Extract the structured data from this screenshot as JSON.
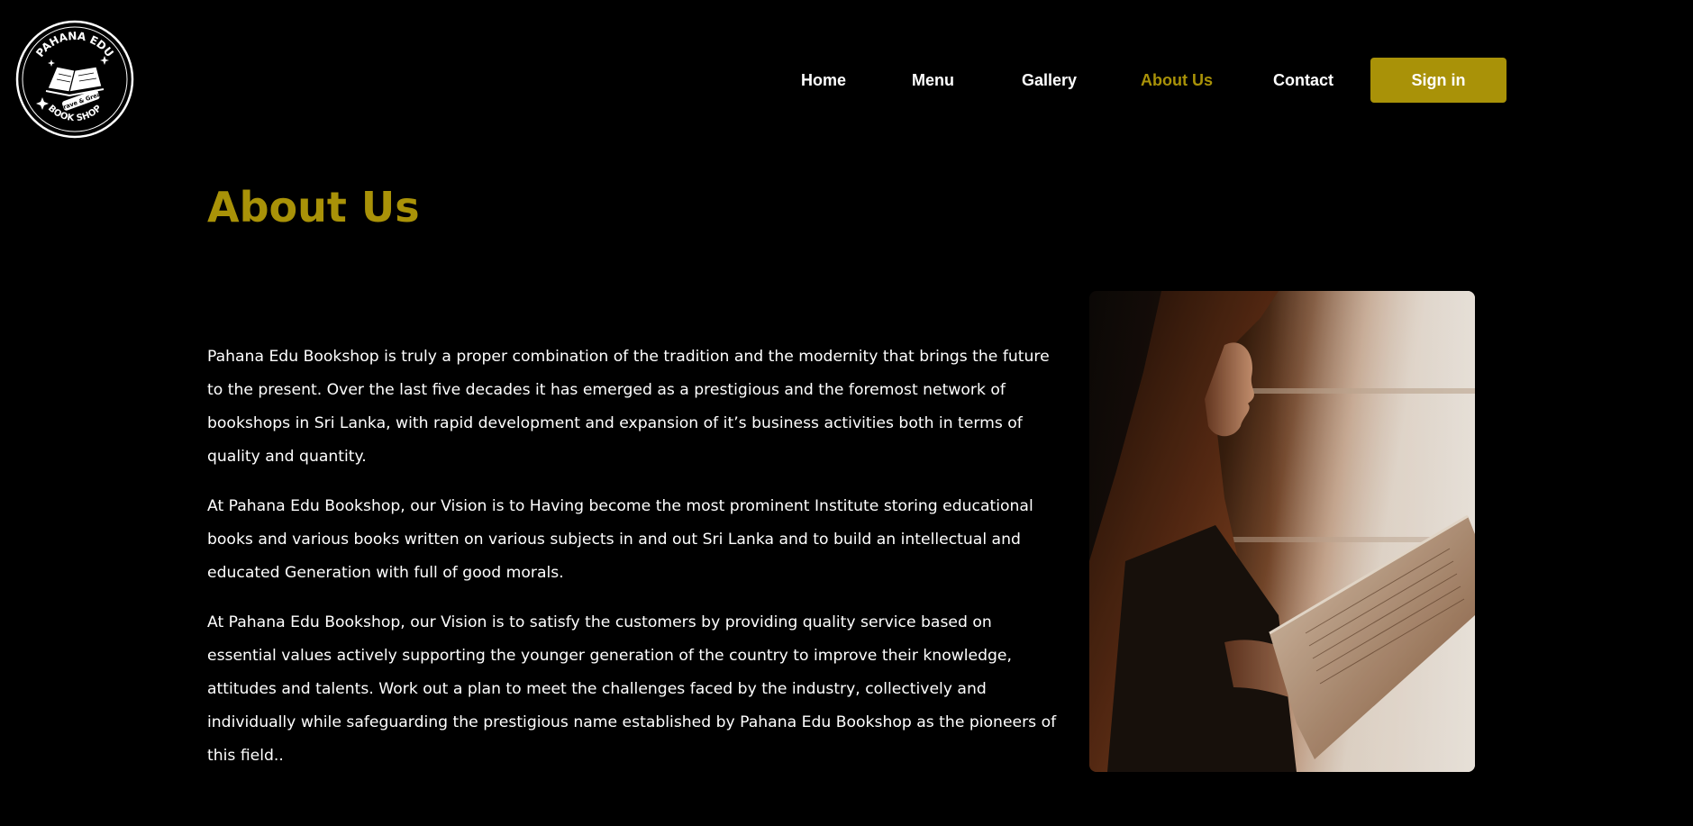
{
  "logo": {
    "top_text": "PAHANA EDU",
    "ribbon_text": "Brave & Great",
    "bottom_text": "BOOK SHOP"
  },
  "nav": {
    "items": [
      {
        "label": "Home"
      },
      {
        "label": "Menu"
      },
      {
        "label": "Gallery"
      },
      {
        "label": "About Us",
        "active": true
      },
      {
        "label": "Contact"
      }
    ],
    "signin_label": "Sign in"
  },
  "page": {
    "title": "About Us",
    "paragraphs": [
      "Pahana Edu Bookshop is truly a proper combination of the tradition and the modernity that brings the future to the present. Over the last five decades it has emerged as a prestigious and the foremost network of bookshops in Sri Lanka, with rapid development and expansion of it’s business activities both in terms of quality and quantity.",
      "At Pahana Edu Bookshop, our Vision is to Having become the most prominent Institute storing educational books and various books written on various subjects in and out Sri Lanka and to build an intellectual and educated Generation with full of good morals.",
      "At Pahana Edu Bookshop, our Vision is to satisfy the customers by providing quality service based on essential values actively supporting the younger generation of the country to improve their knowledge, attitudes and talents. Work out a plan to meet the challenges faced by the industry, collectively and individually while safeguarding the prestigious name established by Pahana Edu Bookshop as the pioneers of this field.."
    ]
  },
  "colors": {
    "background": "#000000",
    "accent": "#a99208",
    "text": "#ffffff"
  }
}
